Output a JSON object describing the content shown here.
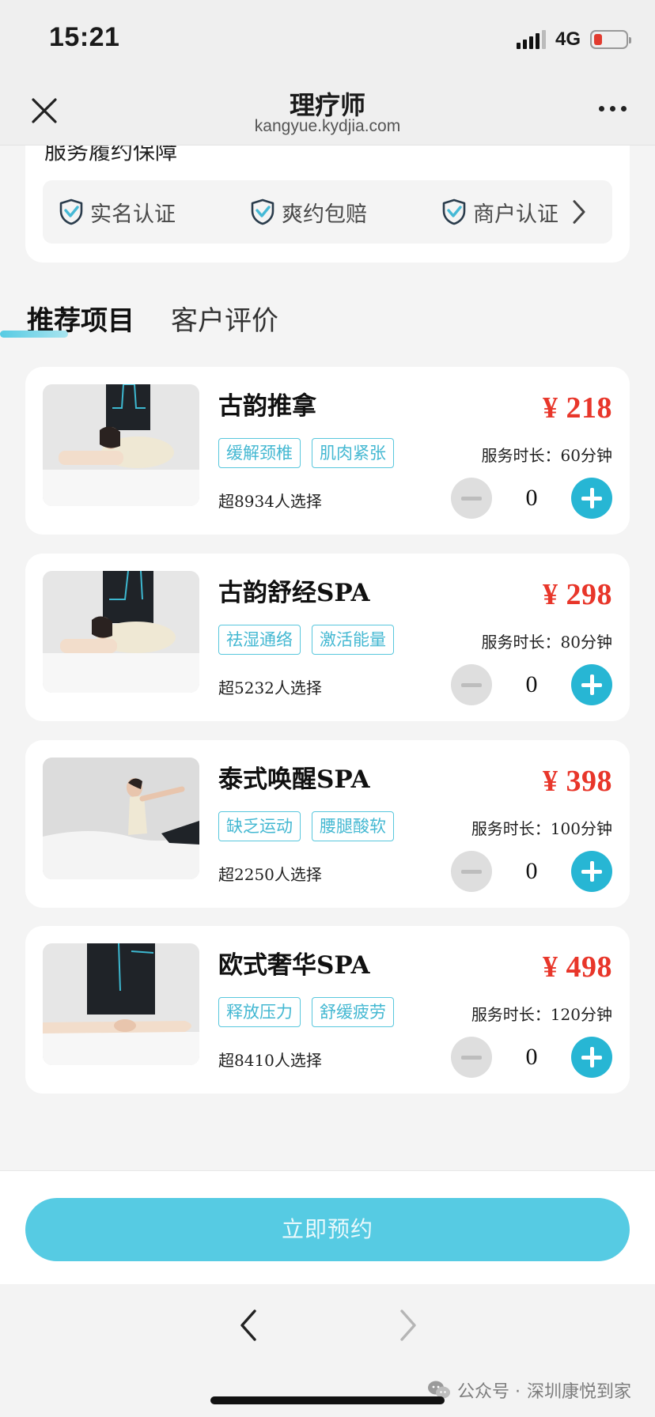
{
  "status_bar": {
    "time": "15:21",
    "network": "4G"
  },
  "header": {
    "title": "理疗师",
    "subtitle": "kangyue.kydjia.com"
  },
  "guarantee": {
    "section_title": "服务履约保障",
    "items": [
      {
        "label": "实名认证",
        "icon": "shield-check-icon"
      },
      {
        "label": "爽约包赔",
        "icon": "shield-check-icon"
      },
      {
        "label": "商户认证",
        "icon": "shield-check-icon"
      }
    ]
  },
  "tabs": [
    {
      "label": "推荐项目",
      "active": true
    },
    {
      "label": "客户评价",
      "active": false
    }
  ],
  "services": [
    {
      "name": "古韵推拿",
      "tags": [
        "缓解颈椎",
        "肌肉紧张"
      ],
      "popularity": "超8934人选择",
      "price": "¥ 218",
      "duration": "服务时长：60分钟",
      "quantity": "0"
    },
    {
      "name": "古韵舒经SPA",
      "tags": [
        "祛湿通络",
        "激活能量"
      ],
      "popularity": "超5232人选择",
      "price": "¥ 298",
      "duration": "服务时长：80分钟",
      "quantity": "0"
    },
    {
      "name": "泰式唤醒SPA",
      "tags": [
        "缺乏运动",
        "腰腿酸软"
      ],
      "popularity": "超2250人选择",
      "price": "¥ 398",
      "duration": "服务时长：100分钟",
      "quantity": "0"
    },
    {
      "name": "欧式奢华SPA",
      "tags": [
        "释放压力",
        "舒缓疲劳"
      ],
      "popularity": "超8410人选择",
      "price": "¥ 498",
      "duration": "服务时长：120分钟",
      "quantity": "0"
    }
  ],
  "footer": {
    "book_button": "立即预约"
  },
  "watermark": {
    "prefix": "公众号 · ",
    "name": "深圳康悦到家"
  },
  "colors": {
    "accent": "#56cbe3",
    "price": "#e8362a",
    "tag": "#44b8d2"
  }
}
